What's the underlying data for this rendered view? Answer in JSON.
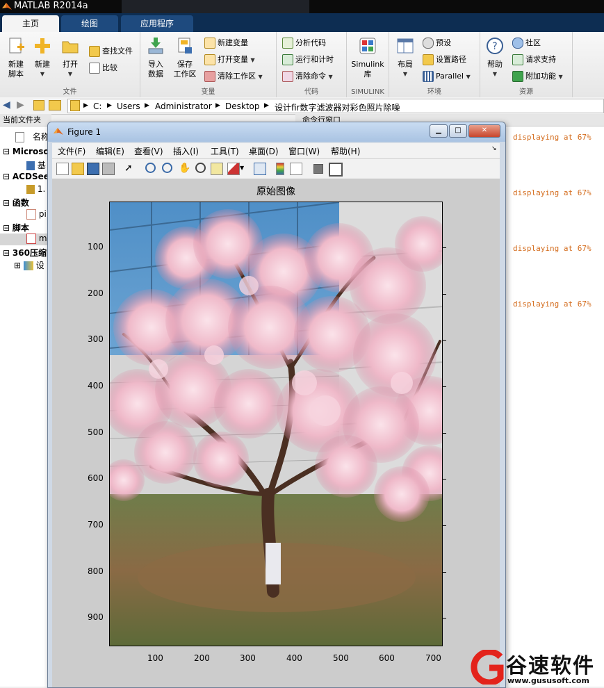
{
  "app": {
    "title": "MATLAB R2014a"
  },
  "tabs": [
    {
      "label": "主页"
    },
    {
      "label": "绘图"
    },
    {
      "label": "应用程序"
    }
  ],
  "ribbon": {
    "file": {
      "label": "文件",
      "new_script": "新建\n脚本",
      "new": "新建",
      "open": "打开",
      "find_files": "查找文件",
      "compare": "比较"
    },
    "variable": {
      "label": "变量",
      "import": "导入\n数据",
      "save_ws": "保存\n工作区",
      "new_var": "新建变量",
      "open_var": "打开变量",
      "clear_ws": "清除工作区"
    },
    "code": {
      "label": "代码",
      "analyze": "分析代码",
      "run_time": "运行和计时",
      "clear_cmd": "清除命令"
    },
    "simulink": {
      "label": "SIMULINK",
      "lib": "Simulink\n库"
    },
    "env": {
      "label": "环境",
      "layout": "布局",
      "prefs": "预设",
      "set_path": "设置路径",
      "parallel": "Parallel"
    },
    "resources": {
      "label": "资源",
      "help": "帮助",
      "community": "社区",
      "support": "请求支持",
      "addons": "附加功能"
    }
  },
  "path": {
    "crumbs": [
      "C:",
      "Users",
      "Administrator",
      "Desktop",
      "设计fir数字滤波器对彩色照片除噪"
    ]
  },
  "left_panel": {
    "title": "当前文件夹",
    "header": "名称",
    "groups": [
      {
        "label": "Microsoft",
        "items": [
          "基"
        ]
      },
      {
        "label": "ACDSee",
        "items": [
          "1."
        ]
      },
      {
        "label": "函数",
        "items": [
          "pi"
        ]
      },
      {
        "label": "脚本",
        "items": [
          "m"
        ]
      },
      {
        "label": "360压缩",
        "items": [
          "设"
        ]
      }
    ]
  },
  "command_window": {
    "title": "命令行窗口",
    "lines": [
      "displaying at 67%",
      "displaying at 67%",
      "displaying at 67%",
      "displaying at 67%"
    ]
  },
  "figure": {
    "title": "Figure 1",
    "menu": [
      "文件(F)",
      "编辑(E)",
      "查看(V)",
      "插入(I)",
      "工具(T)",
      "桌面(D)",
      "窗口(W)",
      "帮助(H)"
    ],
    "axes_title": "原始图像",
    "x_ticks": [
      "100",
      "200",
      "300",
      "400",
      "500",
      "600",
      "700"
    ],
    "y_ticks": [
      "100",
      "200",
      "300",
      "400",
      "500",
      "600",
      "700",
      "800",
      "900"
    ],
    "image": {
      "width": 720,
      "height": 960
    }
  },
  "watermark": {
    "text": "谷速软件",
    "url": "www.gususoft.com"
  },
  "colors": {
    "accent": "#0d2d52",
    "cmd_text": "#d36a1a",
    "canvas_bg": "#cccccc"
  }
}
